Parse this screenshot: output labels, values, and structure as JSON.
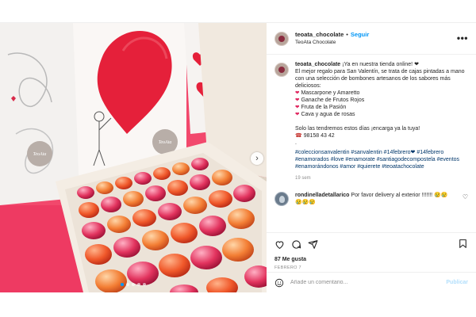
{
  "post": {
    "image_alt": "Caja de bombones San Valentín TeoAta",
    "box_logo_text": "TeoAta",
    "carousel_dots": 5,
    "carousel_active": 0
  },
  "header": {
    "username": "teoata_chocolate",
    "separator": "•",
    "follow_label": "Seguir",
    "subtitle": "TeoAta Chocolate",
    "more_label": "•••"
  },
  "caption": {
    "username": "teoata_chocolate",
    "lines": [
      "¡Ya en nuestra tienda online! ❤",
      "El mejor regalo para San Valentín, se trata de cajas pintadas a mano con una selección de bombones artesanos de los sabores más deliciosos:"
    ],
    "flavors": [
      "Mascarpone y Amaretto",
      "Ganache de Frutos Rojos",
      "Fruta de la Pasión",
      "Cava y agua de rosas"
    ],
    "closing": "Solo las tendremos estos días ¡encarga ya la tuya!",
    "phone": "98158 43 42",
    "dot": ".",
    "hashtags": "#coleccionsanvalentin #sanvalentin #14febrero❤ #14febrero #enamorados #love #enamorate #santiagodecompostela #eventos #enamorándonos #amor #quierete #teoatachocolate",
    "time": "19 sem"
  },
  "comment": {
    "username": "rondinelladetallarico",
    "text": "Por favor delivery al exterior !!!!!!! 😢😢😢😢😢"
  },
  "actions": {
    "likes": "87 Me gusta",
    "date": "FEBRERO 7"
  },
  "add_comment": {
    "placeholder": "Añade un comentario...",
    "publish_label": "Publicar"
  },
  "colors": {
    "accent": "#0095f6",
    "heart_red": "#e0245e",
    "background_pink": "#f03f63"
  }
}
